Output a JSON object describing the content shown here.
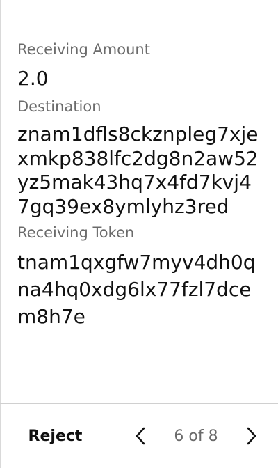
{
  "details": {
    "amount_label": "Receiving Amount",
    "amount_value": "2.0",
    "destination_label": "Destination",
    "destination_value": "znam1dfls8ckznpleg7xjexmkp838lfc2dg8n2aw52yz5mak43hq7x4fd7kvj47gq39ex8ymlyhz3red",
    "token_label": "Receiving Token",
    "token_value": "tnam1qxgfw7myv4dh0qna4hq0xdg6lx77fzl7dcem8h7e"
  },
  "footer": {
    "reject_label": "Reject",
    "page_indicator": "6 of 8",
    "prev_icon": "chevron-left-icon",
    "next_icon": "chevron-right-icon"
  }
}
